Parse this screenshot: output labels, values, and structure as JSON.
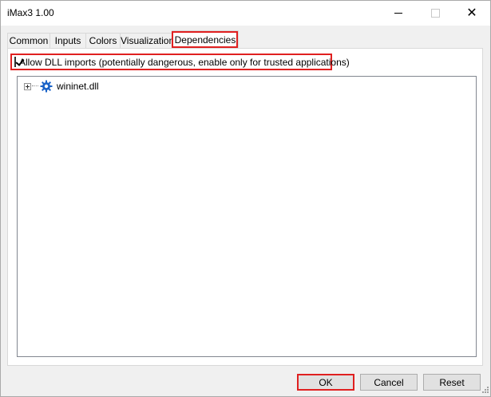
{
  "window": {
    "title": "iMax3 1.00",
    "close_glyph": "✕"
  },
  "tabs": [
    {
      "label": "Common",
      "selected": false
    },
    {
      "label": "Inputs",
      "selected": false
    },
    {
      "label": "Colors",
      "selected": false
    },
    {
      "label": "Visualization",
      "selected": false
    },
    {
      "label": "Dependencies",
      "selected": true
    }
  ],
  "dependencies": {
    "allow_dll_label": "Allow DLL imports (potentially dangerous, enable only for trusted applications)",
    "allow_dll_checked": true,
    "tree_items": [
      {
        "label": "wininet.dll",
        "icon": "gear-icon",
        "expanded": false
      }
    ]
  },
  "buttons": {
    "ok": "OK",
    "cancel": "Cancel",
    "reset": "Reset"
  },
  "colors": {
    "highlight": "#e02020",
    "gear": "#1a63c8"
  }
}
